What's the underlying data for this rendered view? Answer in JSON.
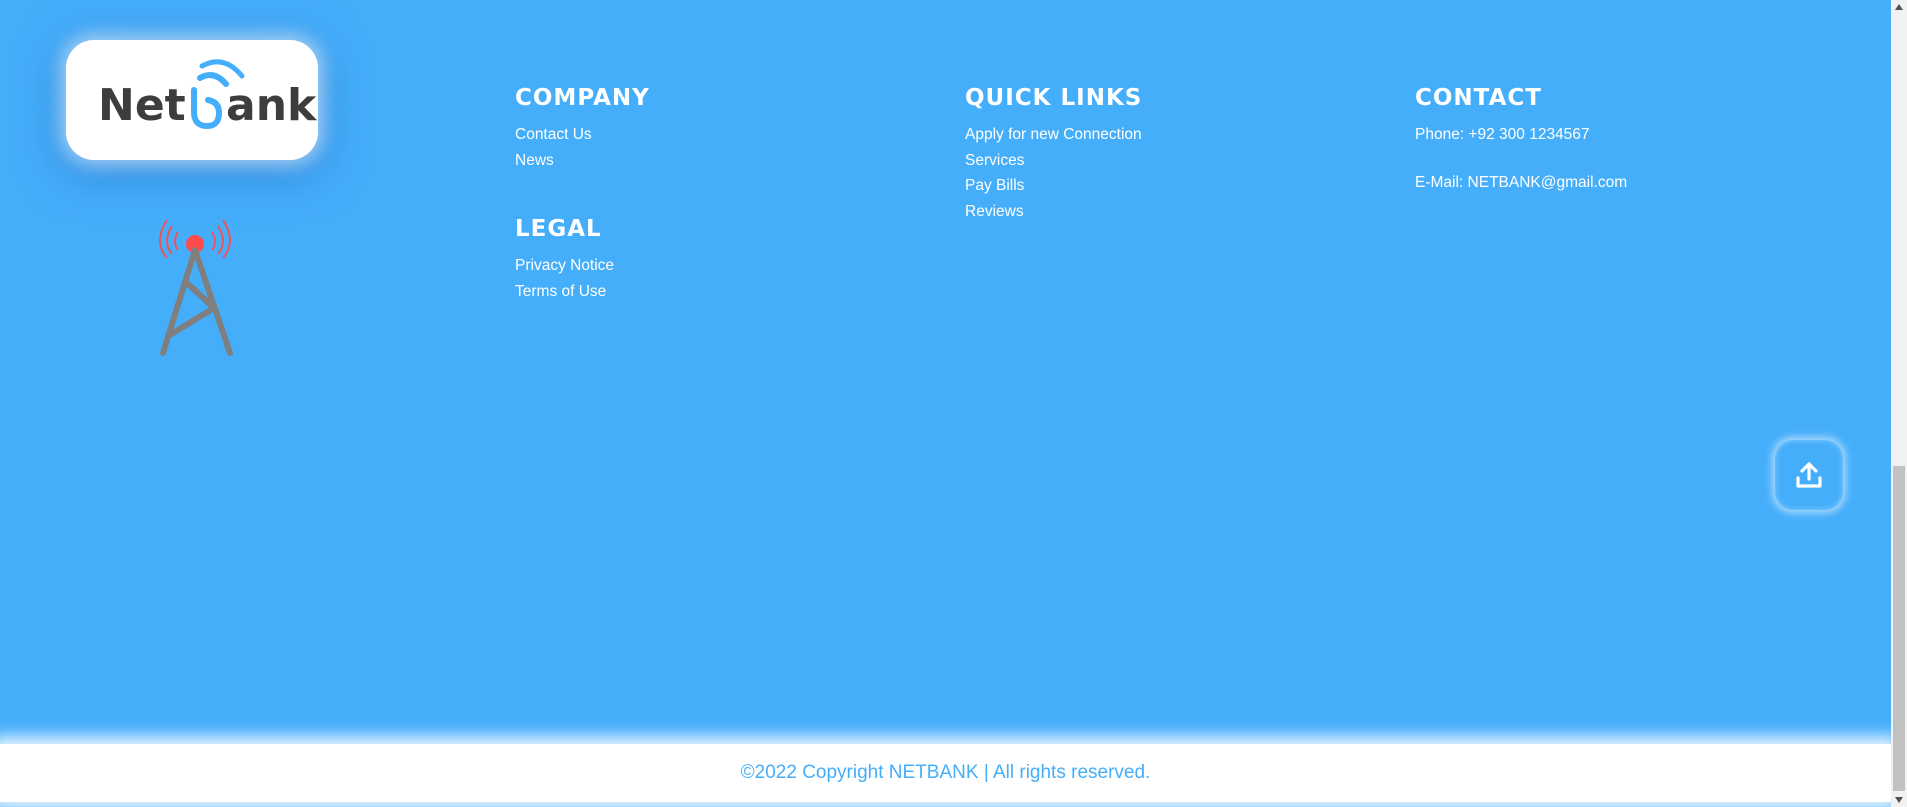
{
  "brand": {
    "logo_text_part1": "Net",
    "logo_text_part2": "ank",
    "logo_text_color": "#3d3d3d",
    "logo_accent_color": "#45aefb"
  },
  "colors": {
    "background": "#45aefb",
    "text": "#ffffff",
    "copyright_bar": "#ffffff",
    "tower_signal": "#ff4b4b",
    "tower_body": "#7f7f7f"
  },
  "company": {
    "heading": "COMPANY",
    "links": [
      "Contact Us",
      "News"
    ]
  },
  "legal": {
    "heading": "LEGAL",
    "links": [
      "Privacy Notice",
      "Terms of Use"
    ]
  },
  "quick_links": {
    "heading": "QUICK LINKS",
    "links": [
      "Apply for new Connection",
      "Services",
      "Pay Bills",
      "Reviews"
    ]
  },
  "contact": {
    "heading": "CONTACT",
    "phone": "Phone: +92 300 1234567",
    "email": "E-Mail: NETBANK@gmail.com"
  },
  "scroll_top": {
    "icon": "upload-icon"
  },
  "copyright": {
    "text": "©2022 Copyright NETBANK | All rights reserved."
  }
}
